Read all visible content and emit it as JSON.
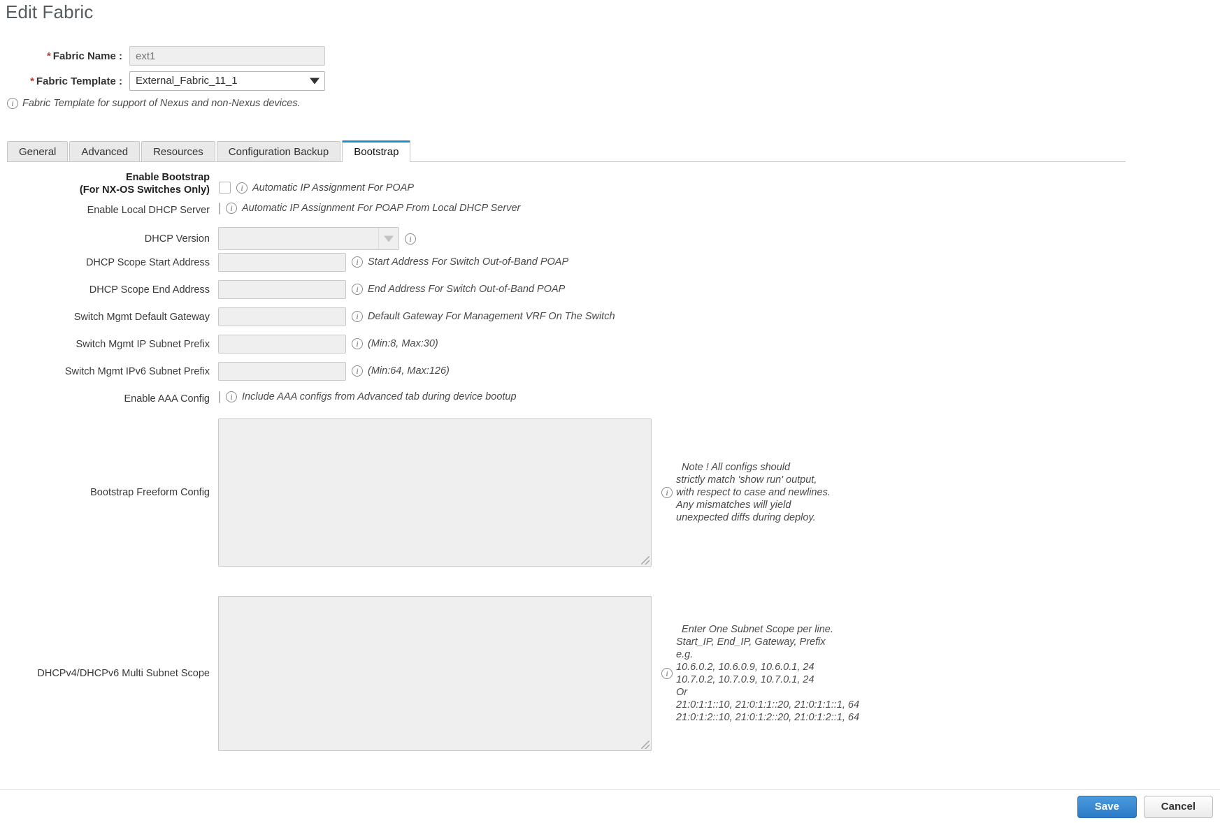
{
  "header": {
    "title": "Edit Fabric",
    "fabric_name_label": "Fabric Name :",
    "fabric_name_value": "",
    "fabric_name_placeholder": "ext1",
    "fabric_template_label": "Fabric Template :",
    "fabric_template_value": "External_Fabric_11_1",
    "template_hint": "Fabric Template for support of Nexus and non-Nexus devices.",
    "required_marker": "*"
  },
  "tabs": [
    {
      "label": "General",
      "active": false
    },
    {
      "label": "Advanced",
      "active": false
    },
    {
      "label": "Resources",
      "active": false
    },
    {
      "label": "Configuration Backup",
      "active": false
    },
    {
      "label": "Bootstrap",
      "active": true
    }
  ],
  "bootstrap": {
    "enable_bootstrap": {
      "label_line1": "Enable Bootstrap",
      "label_line2": "(For NX-OS Switches Only)",
      "checked": false,
      "hint": "Automatic IP Assignment For POAP"
    },
    "enable_local_dhcp": {
      "label": "Enable Local DHCP Server",
      "checked": false,
      "hint": "Automatic IP Assignment For POAP From Local DHCP Server"
    },
    "dhcp_version": {
      "label": "DHCP Version",
      "value": "",
      "hint": ""
    },
    "dhcp_scope_start": {
      "label": "DHCP Scope Start Address",
      "value": "",
      "hint": "Start Address For Switch Out-of-Band POAP"
    },
    "dhcp_scope_end": {
      "label": "DHCP Scope End Address",
      "value": "",
      "hint": "End Address For Switch Out-of-Band POAP"
    },
    "switch_mgmt_gateway": {
      "label": "Switch Mgmt Default Gateway",
      "value": "",
      "hint": "Default Gateway For Management VRF On The Switch"
    },
    "switch_mgmt_ip_prefix": {
      "label": "Switch Mgmt IP Subnet Prefix",
      "value": "",
      "hint": "(Min:8, Max:30)"
    },
    "switch_mgmt_ipv6_prefix": {
      "label": "Switch Mgmt IPv6 Subnet Prefix",
      "value": "",
      "hint": "(Min:64, Max:126)"
    },
    "enable_aaa": {
      "label": "Enable AAA Config",
      "checked": false,
      "hint": "Include AAA configs from Advanced tab during device bootup"
    },
    "bootstrap_freeform": {
      "label": "Bootstrap Freeform Config",
      "value": "",
      "note": "  Note ! All configs should\nstrictly match 'show run' output,\nwith respect to case and newlines.\nAny mismatches will yield\nunexpected diffs during deploy."
    },
    "multi_subnet_scope": {
      "label": "DHCPv4/DHCPv6 Multi Subnet Scope",
      "value": "",
      "note": "  Enter One Subnet Scope per line.\nStart_IP, End_IP, Gateway, Prefix\ne.g.\n10.6.0.2, 10.6.0.9, 10.6.0.1, 24\n10.7.0.2, 10.7.0.9, 10.7.0.1, 24\nOr\n21:0:1:1::10, 21:0:1:1::20, 21:0:1:1::1, 64\n21:0:1:2::10, 21:0:1:2::20, 21:0:1:2::1, 64"
    }
  },
  "footer": {
    "save_label": "Save",
    "cancel_label": "Cancel"
  },
  "icons": {
    "info": "i",
    "dropdown": "chevron-down-icon"
  },
  "colors": {
    "accent": "#1e90d2",
    "required": "#c0392b",
    "save_button": "#2b7ac7"
  }
}
